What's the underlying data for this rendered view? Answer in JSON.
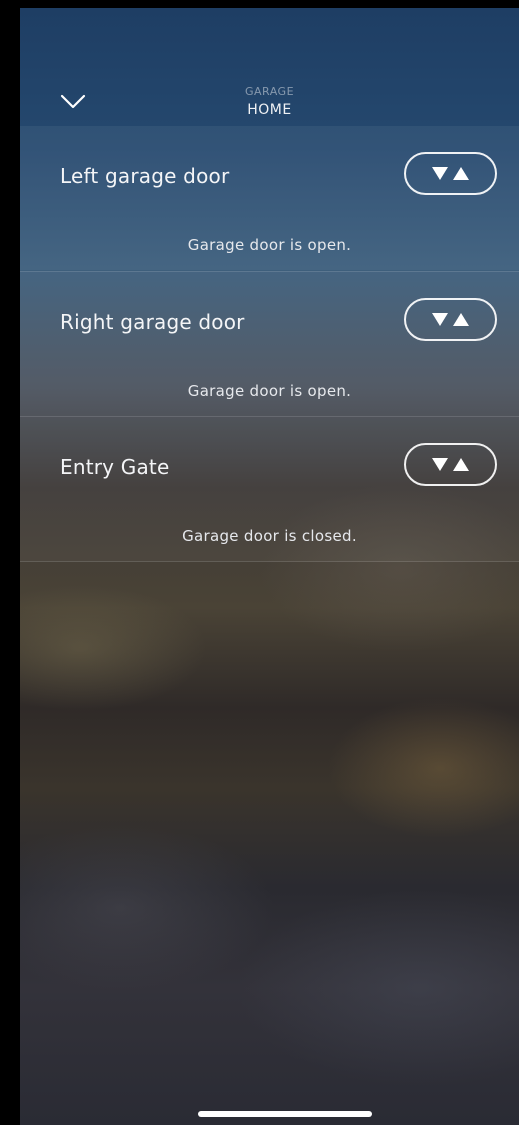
{
  "header": {
    "subtitle": "GARAGE",
    "title": "HOME",
    "collapse_icon": "chevron-down-icon"
  },
  "devices": [
    {
      "name": "Left garage door",
      "status": "Garage door is open.",
      "control_icons": [
        "down-arrow-icon",
        "up-arrow-icon"
      ]
    },
    {
      "name": "Right garage door",
      "status": "Garage door is open.",
      "control_icons": [
        "down-arrow-icon",
        "up-arrow-icon"
      ]
    },
    {
      "name": "Entry Gate",
      "status": "Garage door is closed.",
      "control_icons": [
        "down-arrow-icon",
        "up-arrow-icon"
      ]
    }
  ],
  "colors": {
    "header_bg": "#1f3f66",
    "text": "#ffffff"
  }
}
